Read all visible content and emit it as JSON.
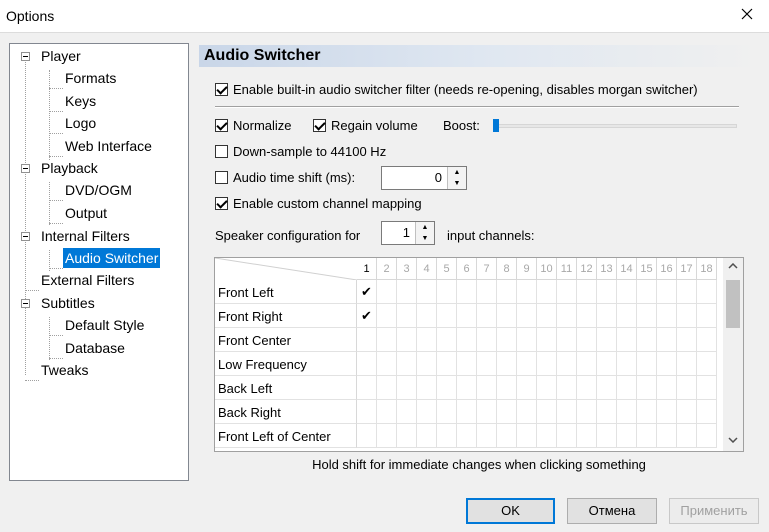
{
  "window": {
    "title": "Options"
  },
  "tree": {
    "player": "Player",
    "formats": "Formats",
    "keys": "Keys",
    "logo": "Logo",
    "web_interface": "Web Interface",
    "playback": "Playback",
    "dvd_ogm": "DVD/OGM",
    "output": "Output",
    "internal_filters": "Internal Filters",
    "audio_switcher": "Audio Switcher",
    "external_filters": "External Filters",
    "subtitles": "Subtitles",
    "default_style": "Default Style",
    "database": "Database",
    "tweaks": "Tweaks"
  },
  "panel": {
    "header": "Audio Switcher",
    "enable_switcher": "Enable built-in audio switcher filter (needs re-opening, disables morgan switcher)",
    "normalize": "Normalize",
    "regain_volume": "Regain volume",
    "boost_label": "Boost:",
    "boost_level": 0.0,
    "downsample": "Down-sample to 44100 Hz",
    "time_shift": "Audio time shift (ms):",
    "time_shift_value": "0",
    "custom_mapping": "Enable custom channel mapping",
    "speaker_config": "Speaker configuration for",
    "speaker_value": "1",
    "input_channels": "input channels:",
    "hint": "Hold shift for immediate changes when clicking something"
  },
  "grid": {
    "columns": [
      "1",
      "2",
      "3",
      "4",
      "5",
      "6",
      "7",
      "8",
      "9",
      "10",
      "11",
      "12",
      "13",
      "14",
      "15",
      "16",
      "17",
      "18"
    ],
    "rows": [
      {
        "label": "Front Left",
        "check": "✔"
      },
      {
        "label": "Front Right",
        "check": "✔"
      },
      {
        "label": "Front Center",
        "check": ""
      },
      {
        "label": "Low Frequency",
        "check": ""
      },
      {
        "label": "Back Left",
        "check": ""
      },
      {
        "label": "Back Right",
        "check": ""
      },
      {
        "label": "Front Left of Center",
        "check": ""
      }
    ]
  },
  "buttons": {
    "ok": "OK",
    "cancel": "Отмена",
    "apply": "Применить"
  },
  "icons": {
    "close": "close-icon",
    "collapse": "minus-icon",
    "scroll_up": "chevron-up-icon",
    "scroll_down": "chevron-down-icon"
  }
}
